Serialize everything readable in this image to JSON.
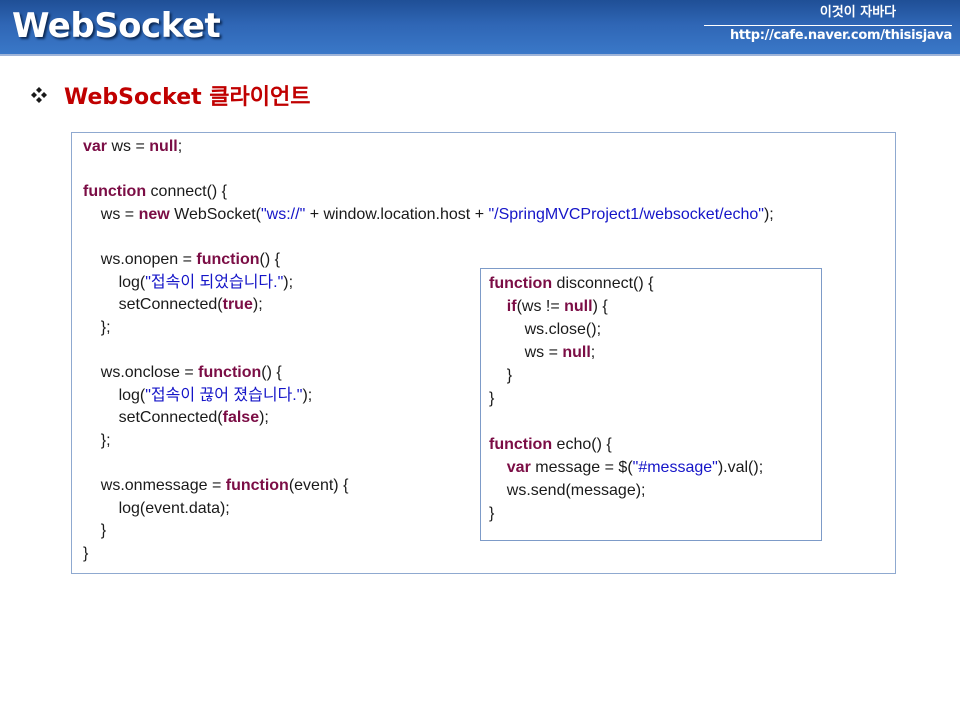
{
  "header": {
    "title": "WebSocket",
    "brand_name": "이것이 자바다",
    "brand_url": "http://cafe.naver.com/thisisjava"
  },
  "section": {
    "icon": "diamond-bullet-icon",
    "title": "WebSocket 클라이언트"
  },
  "colors": {
    "header_blue": "#2f66b5",
    "title_red": "#c00000",
    "keyword": "#7b0d45",
    "string": "#1515c8"
  },
  "code_main": {
    "lines": [
      [
        {
          "t": "var",
          "k": "kw"
        },
        {
          "t": " ws = "
        },
        {
          "t": "null",
          "k": "kw"
        },
        {
          "t": ";"
        }
      ],
      [],
      [
        {
          "t": "function",
          "k": "kw"
        },
        {
          "t": " connect() {"
        }
      ],
      [
        {
          "t": "    ws = "
        },
        {
          "t": "new",
          "k": "kw"
        },
        {
          "t": " WebSocket("
        },
        {
          "t": "\"ws://\"",
          "k": "str"
        },
        {
          "t": " + window.location.host + "
        },
        {
          "t": "\"/SpringMVCProject1/websocket/echo\"",
          "k": "str"
        },
        {
          "t": ");"
        }
      ],
      [],
      [
        {
          "t": "    ws.onopen = "
        },
        {
          "t": "function",
          "k": "kw"
        },
        {
          "t": "() {"
        }
      ],
      [
        {
          "t": "        log("
        },
        {
          "t": "\"접속이 되었습니다.\"",
          "k": "str"
        },
        {
          "t": ");"
        }
      ],
      [
        {
          "t": "        setConnected("
        },
        {
          "t": "true",
          "k": "kw"
        },
        {
          "t": ");"
        }
      ],
      [
        {
          "t": "    };"
        }
      ],
      [],
      [
        {
          "t": "    ws.onclose = "
        },
        {
          "t": "function",
          "k": "kw"
        },
        {
          "t": "() {"
        }
      ],
      [
        {
          "t": "        log("
        },
        {
          "t": "\"접속이 끊어 졌습니다.\"",
          "k": "str"
        },
        {
          "t": ");"
        }
      ],
      [
        {
          "t": "        setConnected("
        },
        {
          "t": "false",
          "k": "kw"
        },
        {
          "t": ");"
        }
      ],
      [
        {
          "t": "    };"
        }
      ],
      [],
      [
        {
          "t": "    ws.onmessage = "
        },
        {
          "t": "function",
          "k": "kw"
        },
        {
          "t": "(event) {"
        }
      ],
      [
        {
          "t": "        log(event.data);"
        }
      ],
      [
        {
          "t": "    }"
        }
      ],
      [
        {
          "t": "}"
        }
      ]
    ]
  },
  "code_side": {
    "lines": [
      [
        {
          "t": "function",
          "k": "kw"
        },
        {
          "t": " disconnect() {"
        }
      ],
      [
        {
          "t": "    "
        },
        {
          "t": "if",
          "k": "kw"
        },
        {
          "t": "(ws != "
        },
        {
          "t": "null",
          "k": "kw"
        },
        {
          "t": ") {"
        }
      ],
      [
        {
          "t": "        ws.close();"
        }
      ],
      [
        {
          "t": "        ws = "
        },
        {
          "t": "null",
          "k": "kw"
        },
        {
          "t": ";"
        }
      ],
      [
        {
          "t": "    }"
        }
      ],
      [
        {
          "t": "}"
        }
      ],
      [],
      [
        {
          "t": "function",
          "k": "kw"
        },
        {
          "t": " echo() {"
        }
      ],
      [
        {
          "t": "    "
        },
        {
          "t": "var",
          "k": "kw"
        },
        {
          "t": " message = $("
        },
        {
          "t": "\"#message\"",
          "k": "str"
        },
        {
          "t": ").val();"
        }
      ],
      [
        {
          "t": "    ws.send(message);"
        }
      ],
      [
        {
          "t": "}"
        }
      ]
    ]
  }
}
